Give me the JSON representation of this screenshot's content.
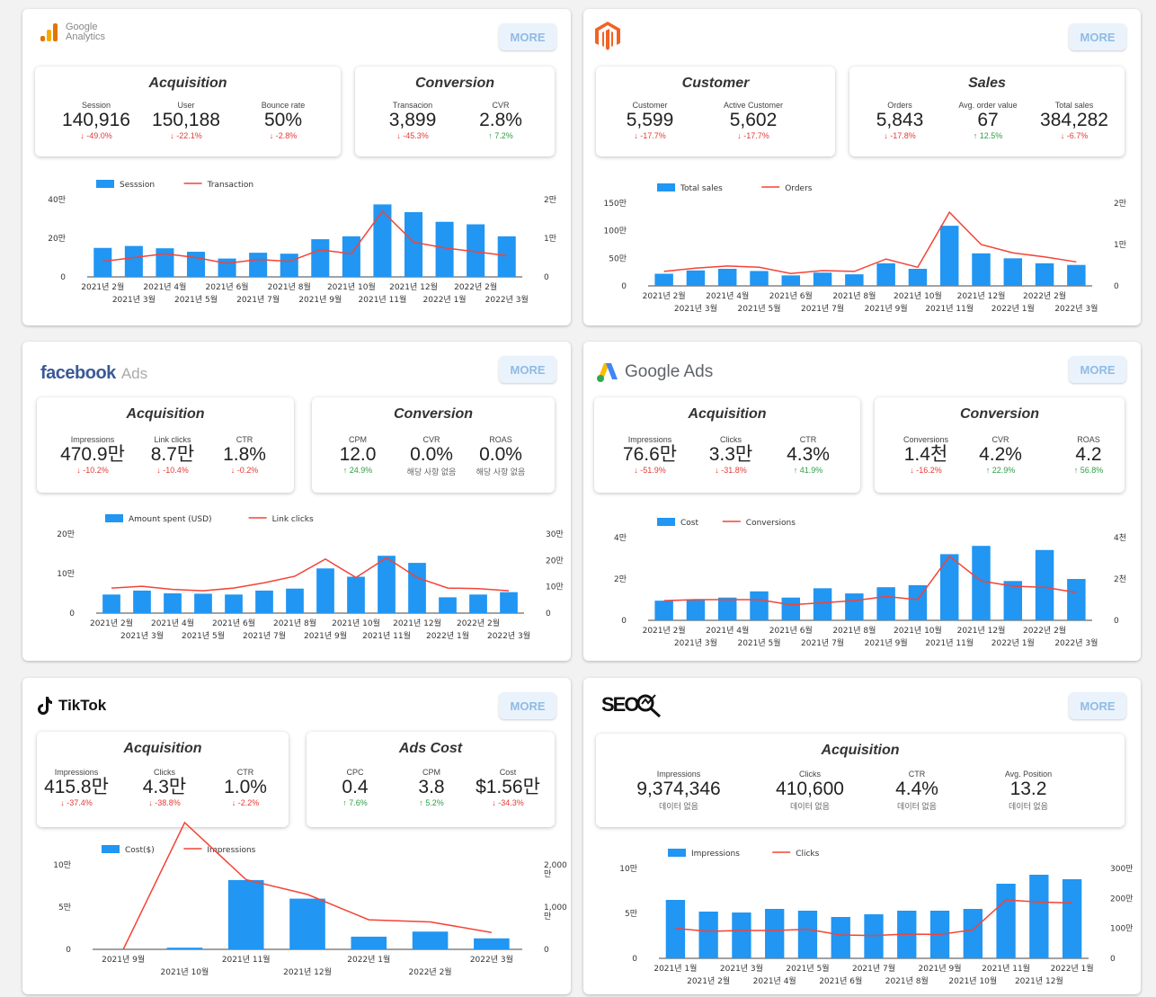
{
  "cards": [
    {
      "id": "ga",
      "logo": {
        "text": "Google\nAnalytics",
        "icon": "google-analytics-icon"
      },
      "more": "MORE",
      "boxes": [
        {
          "title": "Acquisition",
          "metrics": [
            {
              "label": "Session",
              "value": "140,916",
              "delta": "↓ -49.0%",
              "dir": "down"
            },
            {
              "label": "User",
              "value": "150,188",
              "delta": "↓ -22.1%",
              "dir": "down"
            },
            {
              "label": "Bounce rate",
              "value": "50%",
              "delta": "↓ -2.8%",
              "dir": "down"
            }
          ]
        },
        {
          "title": "Conversion",
          "metrics": [
            {
              "label": "Transacion",
              "value": "3,899",
              "delta": "↓ -45.3%",
              "dir": "down"
            },
            {
              "label": "CVR",
              "value": "2.8%",
              "delta": "↑ 7.2%",
              "dir": "up"
            }
          ]
        }
      ]
    },
    {
      "id": "magento",
      "logo": {
        "text": "",
        "icon": "magento-icon"
      },
      "more": "MORE",
      "boxes": [
        {
          "title": "Customer",
          "metrics": [
            {
              "label": "Customer",
              "value": "5,599",
              "delta": "↓ -17.7%",
              "dir": "down"
            },
            {
              "label": "Active Customer",
              "value": "5,602",
              "delta": "↓ -17.7%",
              "dir": "down"
            }
          ]
        },
        {
          "title": "Sales",
          "metrics": [
            {
              "label": "Orders",
              "value": "5,843",
              "delta": "↓ -17.8%",
              "dir": "down"
            },
            {
              "label": "Avg. order value",
              "value": "67",
              "delta": "↑ 12.5%",
              "dir": "up"
            },
            {
              "label": "Total sales",
              "value": "384,282",
              "delta": "↓ -6.7%",
              "dir": "down"
            }
          ]
        }
      ]
    },
    {
      "id": "facebook",
      "logo": {
        "text": "facebook",
        "sub": "Ads",
        "icon": "facebook-icon"
      },
      "more": "MORE",
      "boxes": [
        {
          "title": "Acquisition",
          "metrics": [
            {
              "label": "Impressions",
              "value": "470.9만",
              "delta": "↓ -10.2%",
              "dir": "down"
            },
            {
              "label": "Link clicks",
              "value": "8.7만",
              "delta": "↓ -10.4%",
              "dir": "down"
            },
            {
              "label": "CTR",
              "value": "1.8%",
              "delta": "↓ -0.2%",
              "dir": "down"
            }
          ]
        },
        {
          "title": "Conversion",
          "metrics": [
            {
              "label": "CPM",
              "value": "12.0",
              "delta": "↑ 24.9%",
              "dir": "up"
            },
            {
              "label": "CVR",
              "value": "0.0%",
              "delta": "해당 사항 없음",
              "dir": "na"
            },
            {
              "label": "ROAS",
              "value": "0.0%",
              "delta": "해당 사항 없음",
              "dir": "na"
            }
          ]
        }
      ]
    },
    {
      "id": "googleads",
      "logo": {
        "text": "Google Ads",
        "icon": "google-ads-icon"
      },
      "more": "MORE",
      "boxes": [
        {
          "title": "Acquisition",
          "metrics": [
            {
              "label": "Impressions",
              "value": "76.6만",
              "delta": "↓ -51.9%",
              "dir": "down"
            },
            {
              "label": "Clicks",
              "value": "3.3만",
              "delta": "↓ -31.8%",
              "dir": "down"
            },
            {
              "label": "CTR",
              "value": "4.3%",
              "delta": "↑ 41.9%",
              "dir": "up"
            }
          ]
        },
        {
          "title": "Conversion",
          "metrics": [
            {
              "label": "Conversions",
              "value": "1.4천",
              "delta": "↓ -16.2%",
              "dir": "down"
            },
            {
              "label": "CVR",
              "value": "4.2%",
              "delta": "↑ 22.9%",
              "dir": "up"
            },
            {
              "label": "ROAS",
              "value": "4.2",
              "delta": "↑ 56.8%",
              "dir": "up"
            }
          ]
        }
      ]
    },
    {
      "id": "tiktok",
      "logo": {
        "text": "TikTok",
        "icon": "tiktok-icon"
      },
      "more": "MORE",
      "boxes": [
        {
          "title": "Acquisition",
          "metrics": [
            {
              "label": "Impressions",
              "value": "415.8만",
              "delta": "↓ -37.4%",
              "dir": "down"
            },
            {
              "label": "Clicks",
              "value": "4.3만",
              "delta": "↓ -38.8%",
              "dir": "down"
            },
            {
              "label": "CTR",
              "value": "1.0%",
              "delta": "↓ -2.2%",
              "dir": "down"
            }
          ]
        },
        {
          "title": "Ads Cost",
          "metrics": [
            {
              "label": "CPC",
              "value": "0.4",
              "delta": "↑ 7.6%",
              "dir": "up"
            },
            {
              "label": "CPM",
              "value": "3.8",
              "delta": "↑ 5.2%",
              "dir": "up"
            },
            {
              "label": "Cost",
              "value": "$1.56만",
              "delta": "↓ -34.3%",
              "dir": "down"
            }
          ]
        }
      ]
    },
    {
      "id": "seo",
      "logo": {
        "text": "SEO",
        "icon": "seo-magnifier-icon"
      },
      "more": "MORE",
      "boxes": [
        {
          "title": "Acquisition",
          "metrics": [
            {
              "label": "Impressions",
              "value": "9,374,346",
              "delta": "데이터 없음",
              "dir": "na"
            },
            {
              "label": "Clicks",
              "value": "410,600",
              "delta": "데이터 없음",
              "dir": "na"
            },
            {
              "label": "CTR",
              "value": "4.4%",
              "delta": "데이터 없음",
              "dir": "na"
            },
            {
              "label": "Avg. Position",
              "value": "13.2",
              "delta": "데이터 없음",
              "dir": "na"
            }
          ]
        }
      ]
    }
  ],
  "chart_data": [
    {
      "type": "bar",
      "bar_name": "Sesssion",
      "line_name": "Transaction",
      "categories": [
        "2021년 2월",
        "2021년 3월",
        "2021년 4월",
        "2021년 5월",
        "2021년 6월",
        "2021년 7월",
        "2021년 8월",
        "2021년 9월",
        "2021년 10월",
        "2021년 11월",
        "2021년 12월",
        "2022년 1월",
        "2022년 2월",
        "2022년 3월"
      ],
      "bars": [
        150000,
        160000,
        148000,
        130000,
        95000,
        125000,
        120000,
        195000,
        210000,
        375000,
        335000,
        285000,
        272000,
        210000
      ],
      "line": [
        4000,
        5000,
        6000,
        5000,
        3500,
        4500,
        4000,
        7000,
        6000,
        17000,
        9000,
        7500,
        6500,
        5500
      ],
      "left_ticks": [
        "0",
        "20만",
        "40만"
      ],
      "left_max": 400000,
      "right_ticks": [
        "0",
        "1만",
        "2만"
      ],
      "right_max": 20000
    },
    {
      "type": "bar",
      "bar_name": "Total sales",
      "line_name": "Orders",
      "categories": [
        "2021년 2월",
        "2021년 3월",
        "2021년 4월",
        "2021년 5월",
        "2021년 6월",
        "2021년 7월",
        "2021년 8월",
        "2021년 9월",
        "2021년 10월",
        "2021년 11월",
        "2021년 12월",
        "2022년 1월",
        "2022년 2월",
        "2022년 3월"
      ],
      "bars": [
        22000,
        28000,
        31000,
        27000,
        19000,
        24000,
        21000,
        41000,
        31000,
        109000,
        59000,
        50000,
        41000,
        38000
      ],
      "line": [
        3500,
        4300,
        4800,
        4500,
        3000,
        3700,
        3500,
        6500,
        4500,
        17800,
        10000,
        8000,
        7000,
        5800
      ],
      "left_ticks": [
        "0",
        "50만",
        "100만",
        "150만"
      ],
      "left_max": 150000,
      "right_ticks": [
        "0",
        "1만",
        "2만"
      ],
      "right_max": 20000
    },
    {
      "type": "bar",
      "bar_name": "Amount spent (USD)",
      "line_name": "Link clicks",
      "categories": [
        "2021년 2월",
        "2021년 3월",
        "2021년 4월",
        "2021년 5월",
        "2021년 6월",
        "2021년 7월",
        "2021년 8월",
        "2021년 9월",
        "2021년 10월",
        "2021년 11월",
        "2021년 12월",
        "2022년 1월",
        "2022년 2월",
        "2022년 3월"
      ],
      "bars": [
        47000,
        57000,
        50000,
        49000,
        47000,
        57000,
        62000,
        113000,
        92000,
        145000,
        127000,
        40000,
        47000,
        53000
      ],
      "line": [
        95000,
        102000,
        90000,
        85000,
        95000,
        115000,
        140000,
        205000,
        135000,
        210000,
        135000,
        95000,
        93000,
        85000
      ],
      "left_ticks": [
        "0",
        "10만",
        "20만"
      ],
      "left_max": 200000,
      "right_ticks": [
        "0",
        "10만",
        "20만",
        "30만"
      ],
      "right_max": 300000
    },
    {
      "type": "bar",
      "bar_name": "Cost",
      "line_name": "Conversions",
      "categories": [
        "2021년 2월",
        "2021년 3월",
        "2021년 4월",
        "2021년 5월",
        "2021년 6월",
        "2021년 7월",
        "2021년 8월",
        "2021년 9월",
        "2021년 10월",
        "2021년 11월",
        "2021년 12월",
        "2022년 1월",
        "2022년 2월",
        "2022년 3월"
      ],
      "bars": [
        9500,
        10000,
        11000,
        14000,
        11000,
        15500,
        13000,
        16000,
        17000,
        32000,
        36000,
        19000,
        34000,
        20000
      ],
      "line": [
        9500,
        10000,
        10000,
        10000,
        7500,
        8500,
        9500,
        11500,
        10000,
        31000,
        19000,
        16500,
        16000,
        13500
      ],
      "left_ticks": [
        "0",
        "2만",
        "4만"
      ],
      "left_max": 40000,
      "right_ticks": [
        "0",
        "2천",
        "4천"
      ],
      "right_max": 40000
    },
    {
      "type": "bar",
      "bar_name": "Cost($)",
      "line_name": "Impressions",
      "categories": [
        "2021년 9월",
        "2021년 10월",
        "2021년 11월",
        "2021년 12월",
        "2022년 1월",
        "2022년 2월",
        "2022년 3월"
      ],
      "bars": [
        0,
        2000,
        82000,
        60000,
        15000,
        21000,
        13000
      ],
      "line": [
        0,
        3000,
        1650,
        1300,
        700,
        650,
        400
      ],
      "left_ticks": [
        "0",
        "5만",
        "10만"
      ],
      "left_max": 100000,
      "right_ticks": [
        "0",
        "1,000\n만",
        "2,000\n만"
      ],
      "right_max": 2000
    },
    {
      "type": "bar",
      "bar_name": "Impressions",
      "line_name": "Clicks",
      "categories": [
        "2021년 1월",
        "2021년 2월",
        "2021년 3월",
        "2021년 4월",
        "2021년 5월",
        "2021년 6월",
        "2021년 7월",
        "2021년 8월",
        "2021년 9월",
        "2021년 10월",
        "2021년 11월",
        "2021년 12월",
        "2022년 1월"
      ],
      "bars": [
        65000,
        52000,
        51000,
        55000,
        53000,
        46000,
        49000,
        53000,
        53000,
        55000,
        83000,
        93000,
        88000
      ],
      "line": [
        100000,
        90000,
        93000,
        93000,
        97000,
        78000,
        76000,
        81000,
        80000,
        95000,
        195000,
        188000,
        185000
      ],
      "left_ticks": [
        "0",
        "5만",
        "10만"
      ],
      "left_max": 100000,
      "right_ticks": [
        "0",
        "100만",
        "200만",
        "300만"
      ],
      "right_max": 300000
    }
  ],
  "colors": {
    "bar": "#2196f3",
    "line": "#f44336",
    "down": "#e53935",
    "up": "#2e9e44"
  }
}
